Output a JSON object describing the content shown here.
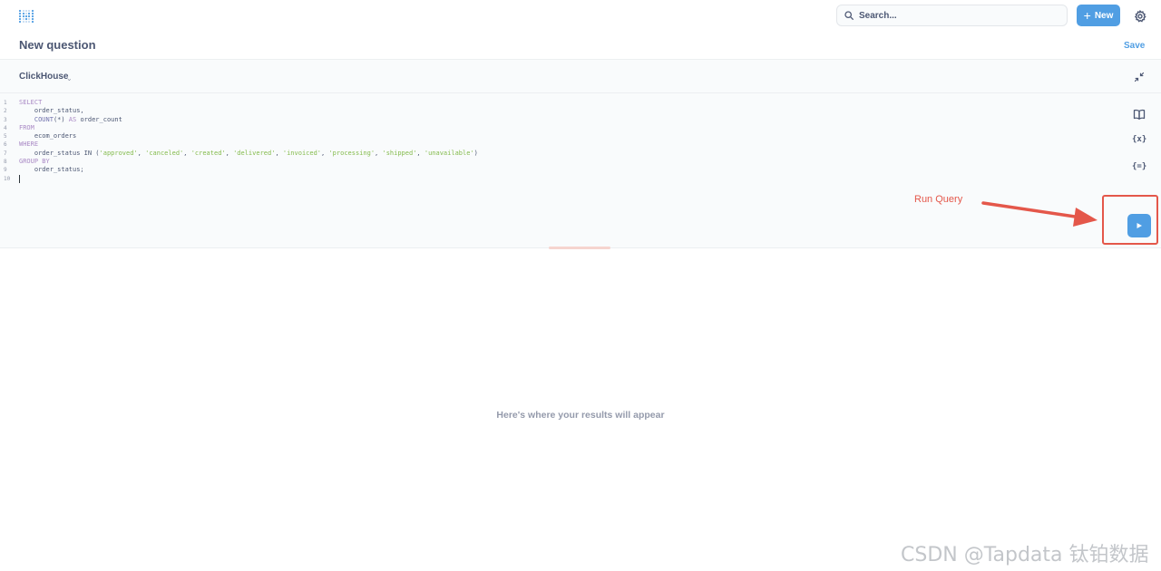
{
  "topbar": {
    "search_placeholder": "Search...",
    "new_label": "New"
  },
  "question": {
    "title": "New question",
    "save_label": "Save"
  },
  "database": {
    "name": "ClickHouse"
  },
  "editor": {
    "line_numbers": [
      "1",
      "2",
      "3",
      "4",
      "5",
      "6",
      "7",
      "8",
      "9",
      "10"
    ],
    "lines": [
      [
        {
          "t": "SELECT",
          "c": "kw"
        }
      ],
      [
        {
          "t": "    order_status,",
          "c": ""
        }
      ],
      [
        {
          "t": "    ",
          "c": ""
        },
        {
          "t": "COUNT",
          "c": "fn"
        },
        {
          "t": "(*) ",
          "c": ""
        },
        {
          "t": "AS",
          "c": "kw"
        },
        {
          "t": " order_count",
          "c": ""
        }
      ],
      [
        {
          "t": "FROM",
          "c": "kw"
        }
      ],
      [
        {
          "t": "    ecom_orders",
          "c": ""
        }
      ],
      [
        {
          "t": "WHERE",
          "c": "kw"
        }
      ],
      [
        {
          "t": "    order_status IN (",
          "c": ""
        },
        {
          "t": "'approved'",
          "c": "str"
        },
        {
          "t": ", ",
          "c": ""
        },
        {
          "t": "'canceled'",
          "c": "str"
        },
        {
          "t": ", ",
          "c": ""
        },
        {
          "t": "'created'",
          "c": "str"
        },
        {
          "t": ", ",
          "c": ""
        },
        {
          "t": "'delivered'",
          "c": "str"
        },
        {
          "t": ", ",
          "c": ""
        },
        {
          "t": "'invoiced'",
          "c": "str"
        },
        {
          "t": ", ",
          "c": ""
        },
        {
          "t": "'processing'",
          "c": "str"
        },
        {
          "t": ", ",
          "c": ""
        },
        {
          "t": "'shipped'",
          "c": "str"
        },
        {
          "t": ", ",
          "c": ""
        },
        {
          "t": "'unavailable'",
          "c": "str"
        },
        {
          "t": ")",
          "c": ""
        }
      ],
      [
        {
          "t": "GROUP BY",
          "c": "kw"
        }
      ],
      [
        {
          "t": "    order_status;",
          "c": ""
        }
      ],
      []
    ],
    "side_icons": {
      "variables": "{x}",
      "snippets": "{=}"
    }
  },
  "annotation": {
    "label": "Run Query",
    "color": "#e4574a"
  },
  "results": {
    "empty_message": "Here's where your results will appear"
  },
  "watermark": "CSDN @Tapdata 钛铂数据",
  "colors": {
    "brand": "#509ee3",
    "text": "#4c5773",
    "muted": "#949aab"
  }
}
